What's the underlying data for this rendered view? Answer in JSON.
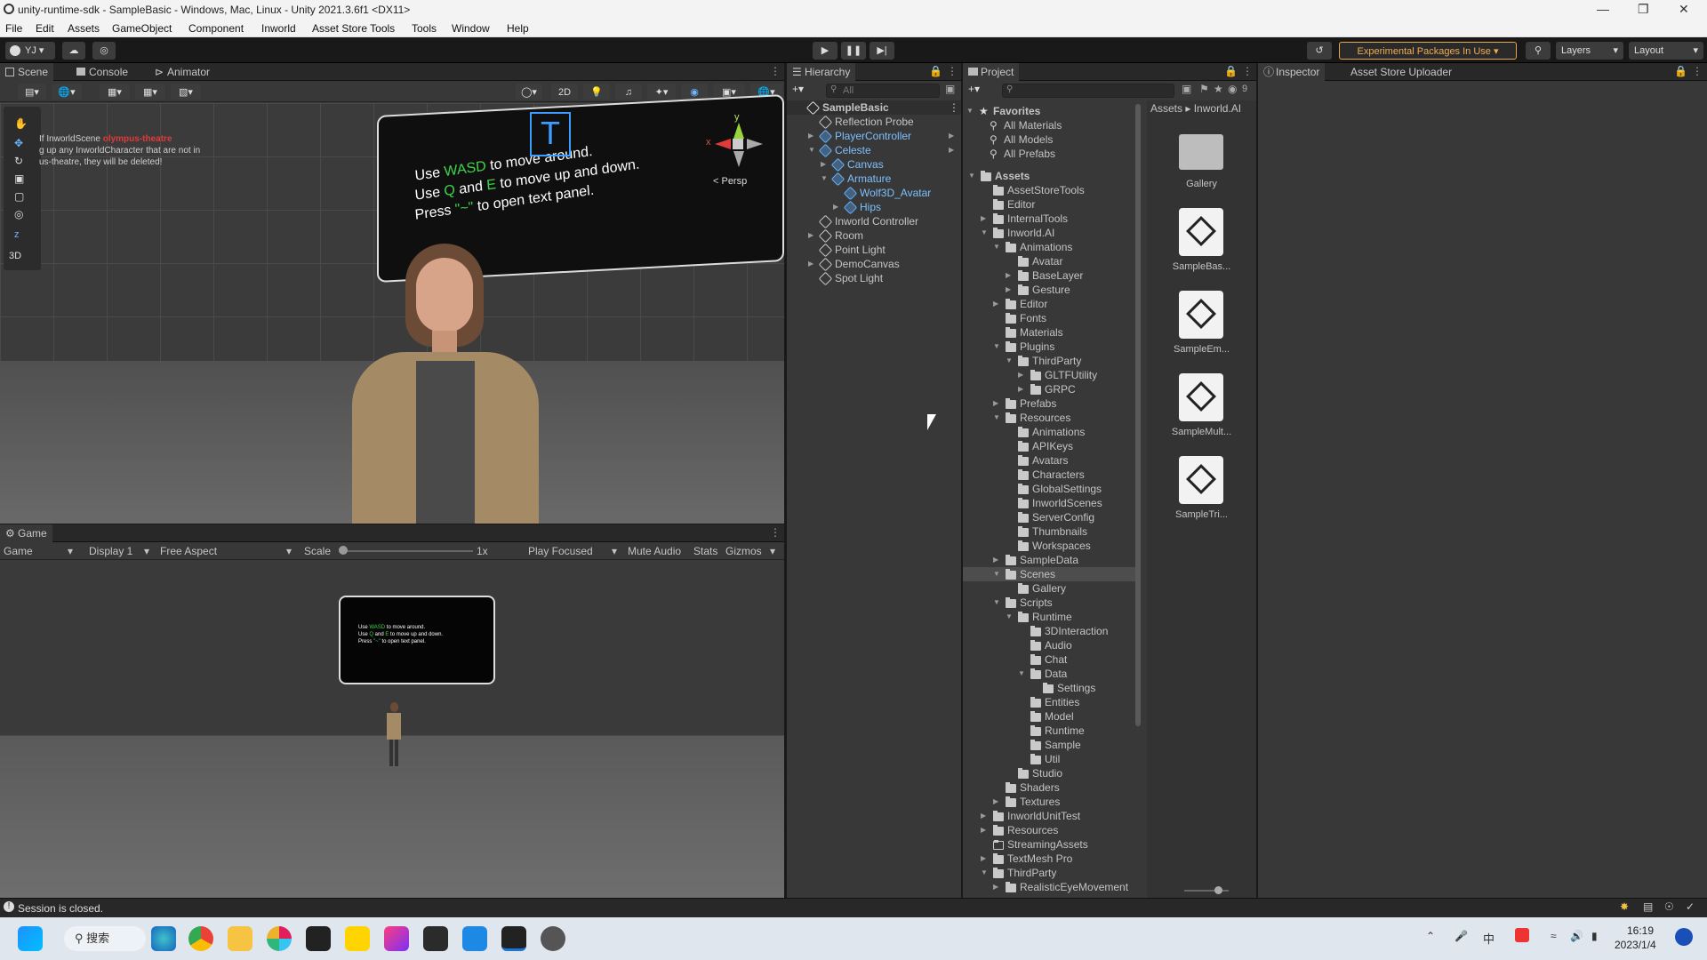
{
  "window": {
    "title": "unity-runtime-sdk - SampleBasic - Windows, Mac, Linux - Unity 2021.3.6f1 <DX11>"
  },
  "menu": [
    "File",
    "Edit",
    "Assets",
    "GameObject",
    "Component",
    "Inworld",
    "Asset Store Tools",
    "Tools",
    "Window",
    "Help"
  ],
  "toolbar": {
    "account": "YJ",
    "experimental": "Experimental Packages In Use",
    "layers": "Layers",
    "layout": "Layout"
  },
  "scene": {
    "tabs": [
      "Scene",
      "Console",
      "Animator"
    ],
    "mode2d": "2D",
    "persp": "< Persp",
    "view3d": "3D",
    "gizmo_x": "x",
    "gizmo_y": "y",
    "gizmo_z": "z",
    "warn_line1": "If InworldScene",
    "warn_scene": "olympus-theatre",
    "warn_line2": "g up any InworldCharacter that are not in",
    "warn_line3": "us-theatre, they will be deleted!",
    "panel_line1_a": "Use ",
    "panel_line1_b": "WASD",
    "panel_line1_c": " to move around.",
    "panel_line2_a": "Use ",
    "panel_line2_b": "Q",
    "panel_line2_c": " and ",
    "panel_line2_d": "E",
    "panel_line2_e": " to move up and down.",
    "panel_line3_a": "Press ",
    "panel_line3_b": "\"~\"",
    "panel_line3_c": " to open text panel."
  },
  "game": {
    "tab": "Game",
    "view": "Game",
    "display": "Display 1",
    "aspect": "Free Aspect",
    "scale_label": "Scale",
    "scale_value": "1x",
    "play_focused": "Play Focused",
    "mute": "Mute Audio",
    "stats": "Stats",
    "gizmos": "Gizmos",
    "mini_l1_a": "Use ",
    "mini_l1_b": "WASD",
    "mini_l1_c": " to move around.",
    "mini_l2_a": "Use ",
    "mini_l2_b": "Q",
    "mini_l2_c": " and ",
    "mini_l2_d": "E",
    "mini_l2_e": " to move up and down.",
    "mini_l3_a": "Press ",
    "mini_l3_b": "\"~\"",
    "mini_l3_c": " to open text panel."
  },
  "hierarchy": {
    "tab": "Hierarchy",
    "search_placeholder": "All",
    "items": [
      {
        "label": "SampleBasic",
        "depth": 0,
        "kind": "scene",
        "open": true,
        "bold": true
      },
      {
        "label": "Reflection Probe",
        "depth": 1,
        "kind": "go"
      },
      {
        "label": "PlayerController",
        "depth": 1,
        "kind": "prefab",
        "fold": "closed",
        "more": true
      },
      {
        "label": "Celeste",
        "depth": 1,
        "kind": "prefab",
        "fold": "open",
        "more": true
      },
      {
        "label": "Canvas",
        "depth": 2,
        "kind": "prefab",
        "fold": "closed"
      },
      {
        "label": "Armature",
        "depth": 2,
        "kind": "prefab",
        "fold": "open"
      },
      {
        "label": "Wolf3D_Avatar",
        "depth": 3,
        "kind": "prefab"
      },
      {
        "label": "Hips",
        "depth": 3,
        "kind": "prefab",
        "fold": "closed"
      },
      {
        "label": "Inworld Controller",
        "depth": 1,
        "kind": "go"
      },
      {
        "label": "Room",
        "depth": 1,
        "kind": "go",
        "fold": "closed"
      },
      {
        "label": "Point Light",
        "depth": 1,
        "kind": "go"
      },
      {
        "label": "DemoCanvas",
        "depth": 1,
        "kind": "go",
        "fold": "closed"
      },
      {
        "label": "Spot Light",
        "depth": 1,
        "kind": "go"
      }
    ]
  },
  "project": {
    "tab": "Project",
    "hidden_count": "9",
    "favorites_label": "Favorites",
    "favorites": [
      "All Materials",
      "All Models",
      "All Prefabs"
    ],
    "breadcrumb": [
      "Assets",
      "Inworld.AI"
    ],
    "tree": [
      {
        "label": "Assets",
        "depth": 0,
        "fold": "open",
        "bold": true
      },
      {
        "label": "AssetStoreTools",
        "depth": 1
      },
      {
        "label": "Editor",
        "depth": 1
      },
      {
        "label": "InternalTools",
        "depth": 1,
        "fold": "closed"
      },
      {
        "label": "Inworld.AI",
        "depth": 1,
        "fold": "open"
      },
      {
        "label": "Animations",
        "depth": 2,
        "fold": "open"
      },
      {
        "label": "Avatar",
        "depth": 3
      },
      {
        "label": "BaseLayer",
        "depth": 3,
        "fold": "closed"
      },
      {
        "label": "Gesture",
        "depth": 3,
        "fold": "closed"
      },
      {
        "label": "Editor",
        "depth": 2,
        "fold": "closed"
      },
      {
        "label": "Fonts",
        "depth": 2
      },
      {
        "label": "Materials",
        "depth": 2
      },
      {
        "label": "Plugins",
        "depth": 2,
        "fold": "open"
      },
      {
        "label": "ThirdParty",
        "depth": 3,
        "fold": "open"
      },
      {
        "label": "GLTFUtility",
        "depth": 4,
        "fold": "closed"
      },
      {
        "label": "GRPC",
        "depth": 4,
        "fold": "closed"
      },
      {
        "label": "Prefabs",
        "depth": 2,
        "fold": "closed"
      },
      {
        "label": "Resources",
        "depth": 2,
        "fold": "open"
      },
      {
        "label": "Animations",
        "depth": 3
      },
      {
        "label": "APIKeys",
        "depth": 3
      },
      {
        "label": "Avatars",
        "depth": 3
      },
      {
        "label": "Characters",
        "depth": 3
      },
      {
        "label": "GlobalSettings",
        "depth": 3
      },
      {
        "label": "InworldScenes",
        "depth": 3
      },
      {
        "label": "ServerConfig",
        "depth": 3
      },
      {
        "label": "Thumbnails",
        "depth": 3
      },
      {
        "label": "Workspaces",
        "depth": 3
      },
      {
        "label": "SampleData",
        "depth": 2,
        "fold": "closed"
      },
      {
        "label": "Scenes",
        "depth": 2,
        "fold": "open",
        "selected": true
      },
      {
        "label": "Gallery",
        "depth": 3
      },
      {
        "label": "Scripts",
        "depth": 2,
        "fold": "open"
      },
      {
        "label": "Runtime",
        "depth": 3,
        "fold": "open"
      },
      {
        "label": "3DInteraction",
        "depth": 4
      },
      {
        "label": "Audio",
        "depth": 4
      },
      {
        "label": "Chat",
        "depth": 4
      },
      {
        "label": "Data",
        "depth": 4,
        "fold": "open"
      },
      {
        "label": "Settings",
        "depth": 5
      },
      {
        "label": "Entities",
        "depth": 4
      },
      {
        "label": "Model",
        "depth": 4
      },
      {
        "label": "Runtime",
        "depth": 4
      },
      {
        "label": "Sample",
        "depth": 4
      },
      {
        "label": "Util",
        "depth": 4
      },
      {
        "label": "Studio",
        "depth": 3
      },
      {
        "label": "Shaders",
        "depth": 2
      },
      {
        "label": "Textures",
        "depth": 2,
        "fold": "closed"
      },
      {
        "label": "InworldUnitTest",
        "depth": 1,
        "fold": "closed"
      },
      {
        "label": "Resources",
        "depth": 1,
        "fold": "closed"
      },
      {
        "label": "StreamingAssets",
        "depth": 1,
        "empty": true
      },
      {
        "label": "TextMesh Pro",
        "depth": 1,
        "fold": "closed"
      },
      {
        "label": "ThirdParty",
        "depth": 1,
        "fold": "open"
      },
      {
        "label": "RealisticEyeMovement",
        "depth": 2,
        "fold": "closed"
      }
    ],
    "assets": [
      {
        "label": "Gallery",
        "kind": "folder"
      },
      {
        "label": "SampleBas...",
        "kind": "scene"
      },
      {
        "label": "SampleEm...",
        "kind": "scene"
      },
      {
        "label": "SampleMult...",
        "kind": "scene"
      },
      {
        "label": "SampleTri...",
        "kind": "scene"
      }
    ]
  },
  "inspector": {
    "tabs": [
      "Inspector",
      "Asset Store Uploader"
    ]
  },
  "status": {
    "message": "Session is closed."
  },
  "taskbar": {
    "search": "搜索",
    "ime": "中",
    "time": "16:19",
    "date": "2023/1/4"
  }
}
